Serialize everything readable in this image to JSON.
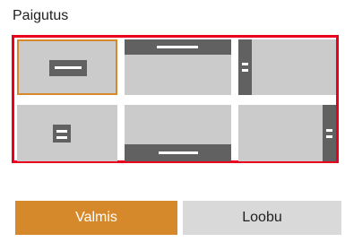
{
  "title": "Paigutus",
  "layout_options": [
    {
      "id": "center-center",
      "selected": true
    },
    {
      "id": "top-center",
      "selected": false
    },
    {
      "id": "left-center",
      "selected": false
    },
    {
      "id": "center-center-small",
      "selected": false
    },
    {
      "id": "bottom-center",
      "selected": false
    },
    {
      "id": "right-center",
      "selected": false
    }
  ],
  "buttons": {
    "done_label": "Valmis",
    "cancel_label": "Loobu"
  },
  "colors": {
    "accent": "#d6892a",
    "selection_frame": "#e8001c",
    "tile_bg": "#cbcbcb",
    "bar": "#616161"
  }
}
